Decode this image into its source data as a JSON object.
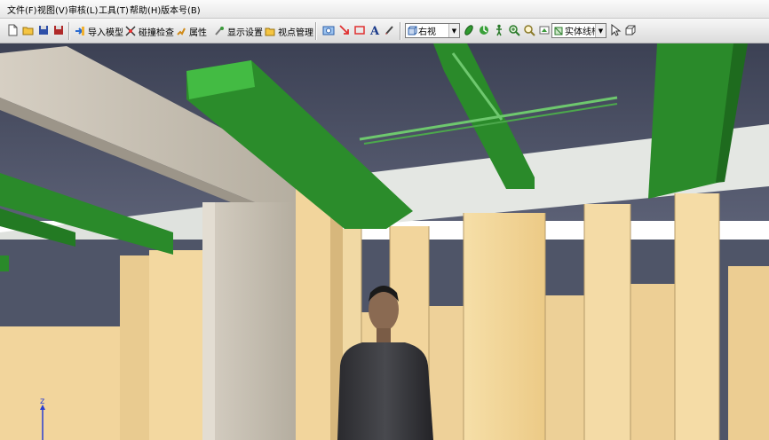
{
  "menu": {
    "file": "文件(F)",
    "view": "视图(V)",
    "review": "审核(L)",
    "tools": "工具(T)",
    "help": "帮助(H)",
    "version": "版本号(B)"
  },
  "toolbar": {
    "import_model": "导入模型",
    "collision_check": "碰撞检查",
    "properties": "属性",
    "display_settings": "显示设置",
    "viewpoint_manager": "视点管理",
    "view_combo": "右视",
    "render_combo": "实体线框"
  },
  "viewport": {
    "axis_label": "z",
    "colors": {
      "ceiling": "#4d5367",
      "beam_green": "#2a8a2a",
      "wall_beige": "#f2d59a",
      "concrete": "#c9c3b8",
      "band_white": "#e6e9e6"
    }
  }
}
